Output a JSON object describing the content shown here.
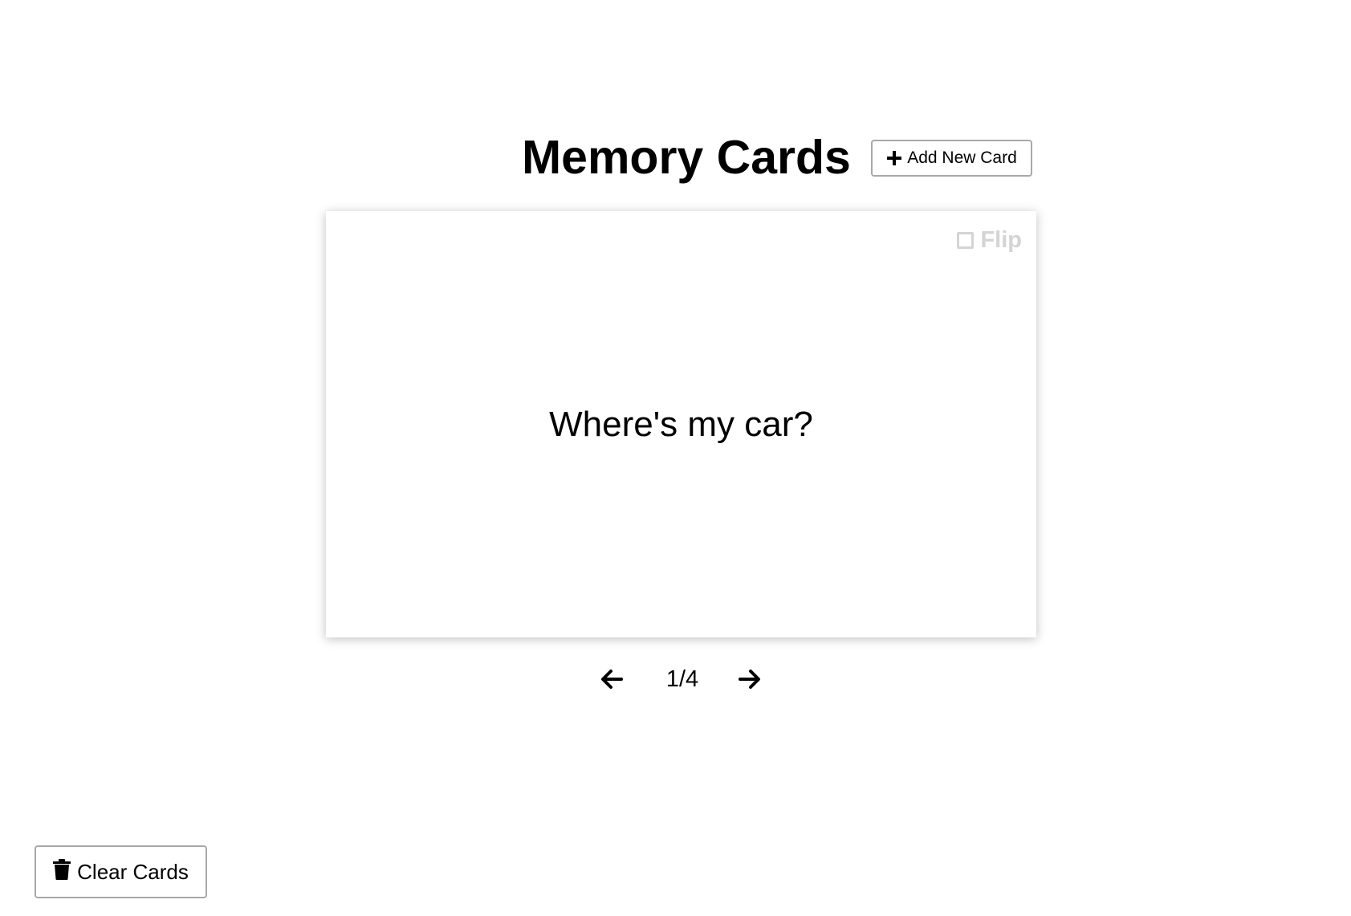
{
  "header": {
    "title": "Memory Cards",
    "add_button_label": "Add New Card",
    "add_button_icon": "plus-icon"
  },
  "card": {
    "text": "Where's my car?",
    "flip_label": "Flip",
    "flip_icon": "checkbox-icon"
  },
  "navigation": {
    "prev_icon": "arrow-left-icon",
    "next_icon": "arrow-right-icon",
    "counter": "1/4"
  },
  "footer": {
    "clear_button_label": "Clear Cards",
    "clear_button_icon": "trash-icon"
  },
  "colors": {
    "flip_muted": "#d4d4d4",
    "button_border": "#a8a8a8"
  }
}
